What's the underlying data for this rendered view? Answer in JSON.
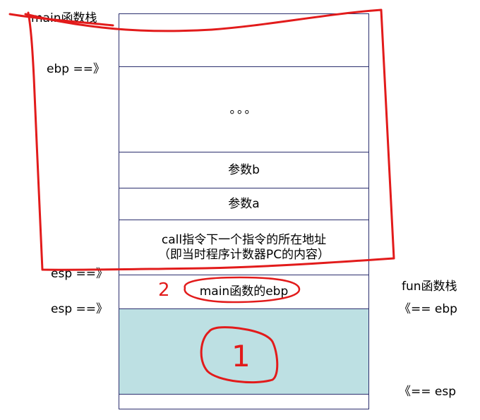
{
  "stack": {
    "rows": [
      {
        "text": ""
      },
      {
        "text": "。。。"
      },
      {
        "text": "参数b"
      },
      {
        "text": "参数a"
      },
      {
        "text": "call指令下一个指令的所在地址\n（即当时程序计数器PC的内容）"
      },
      {
        "text": "main函数的ebp"
      },
      {
        "text": ""
      },
      {
        "text": ""
      }
    ]
  },
  "labels": {
    "main_stack": "main函数栈",
    "ebp_main": "ebp ==》",
    "esp_1": "esp ==》",
    "esp_2": "esp ==》",
    "fun_stack": "fun函数栈",
    "ebp_fun": "《== ebp",
    "esp_fun": "《== esp"
  },
  "annotations": {
    "num_2": "2",
    "num_1": "1",
    "color": "#e21b1b"
  },
  "colors": {
    "border": "#2b2f6e",
    "highlight_fill": "#bde0e3"
  }
}
